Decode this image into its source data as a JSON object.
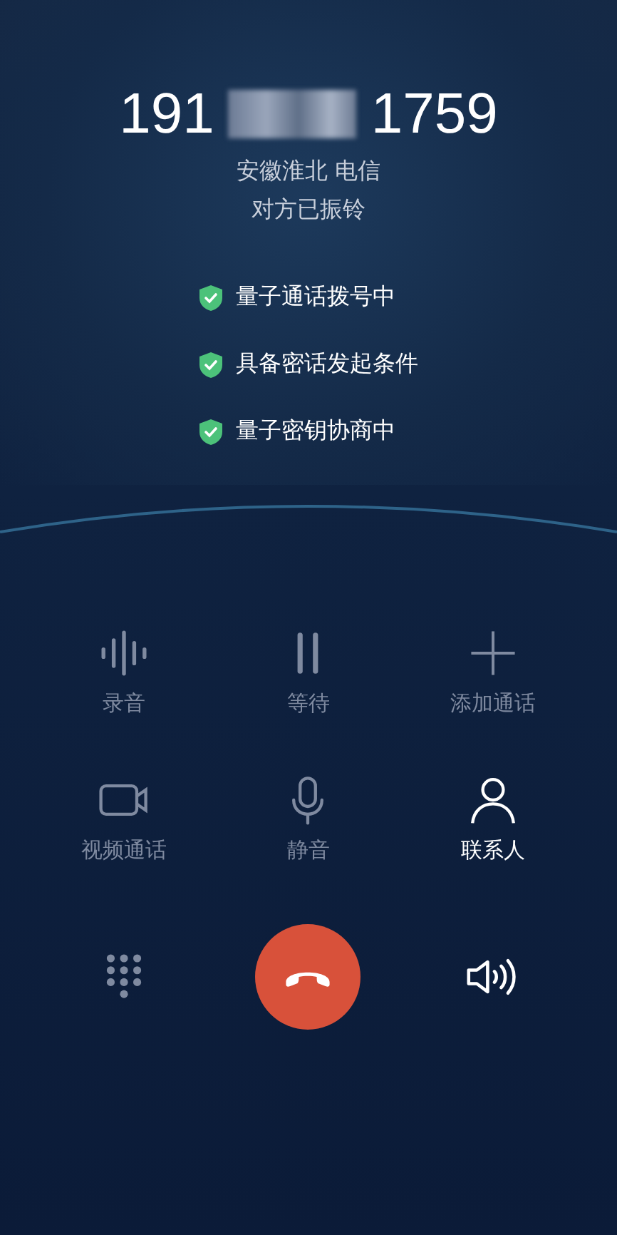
{
  "caller": {
    "number_prefix": "191",
    "number_suffix": "1759",
    "location": "安徽淮北 电信",
    "status": "对方已振铃"
  },
  "checks": [
    {
      "label": "量子通话拨号中"
    },
    {
      "label": "具备密话发起条件"
    },
    {
      "label": "量子密钥协商中"
    }
  ],
  "controls": [
    {
      "kind": "record",
      "label": "录音",
      "disabled": true
    },
    {
      "kind": "hold",
      "label": "等待",
      "disabled": true
    },
    {
      "kind": "add",
      "label": "添加通话",
      "disabled": true
    },
    {
      "kind": "video",
      "label": "视频通话",
      "disabled": true
    },
    {
      "kind": "mute",
      "label": "静音",
      "disabled": true
    },
    {
      "kind": "contacts",
      "label": "联系人",
      "disabled": false
    }
  ],
  "bottom": [
    {
      "kind": "keypad",
      "disabled": true
    },
    {
      "kind": "end",
      "disabled": false
    },
    {
      "kind": "speaker",
      "disabled": false
    }
  ]
}
